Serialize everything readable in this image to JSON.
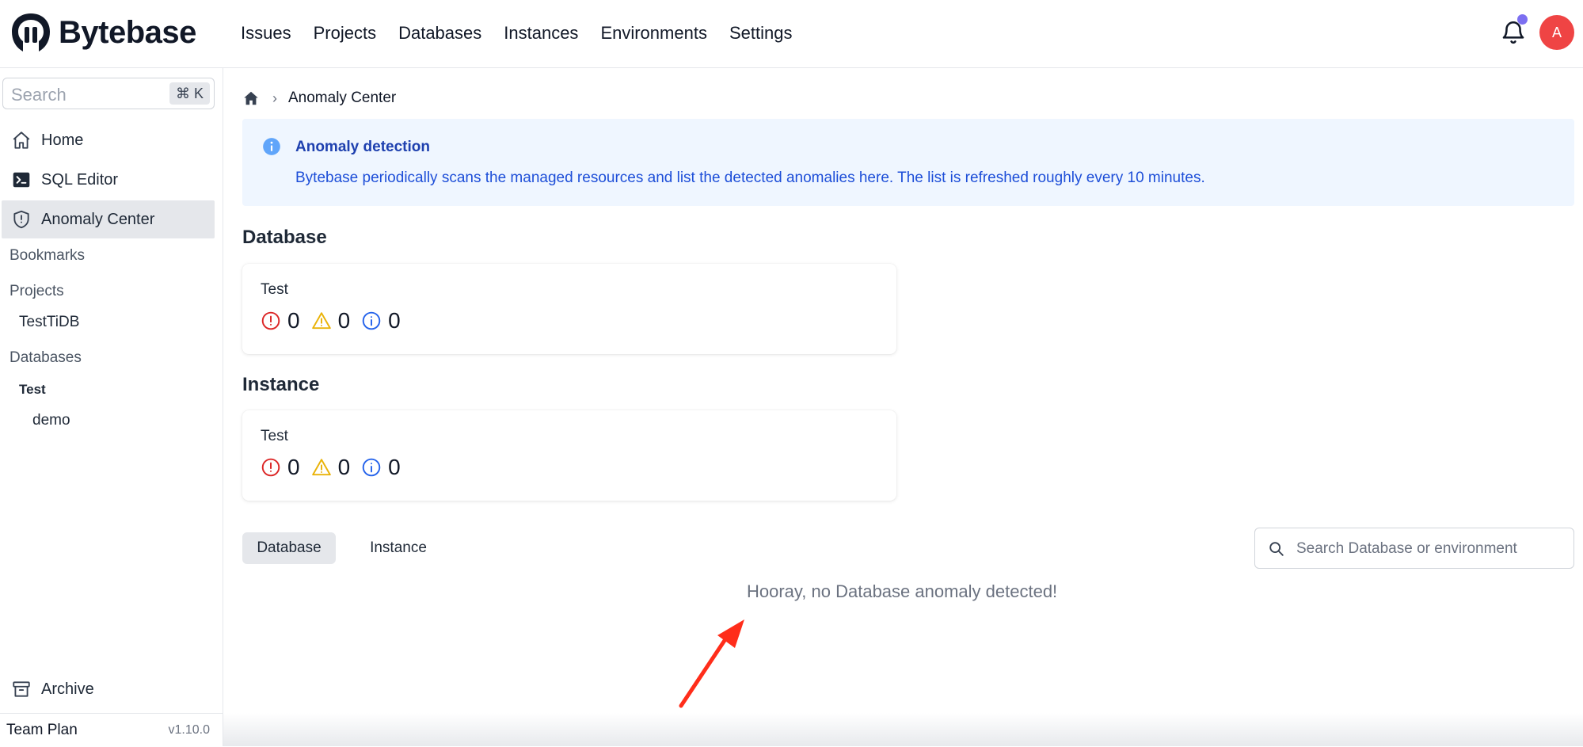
{
  "app": {
    "name": "Bytebase"
  },
  "nav": {
    "items": [
      "Issues",
      "Projects",
      "Databases",
      "Instances",
      "Environments",
      "Settings"
    ]
  },
  "user": {
    "avatar_initial": "A",
    "avatar_color": "#ef4444"
  },
  "sidebar": {
    "search": {
      "placeholder": "Search",
      "shortcut": "⌘ K"
    },
    "items": [
      {
        "label": "Home",
        "icon": "home-icon"
      },
      {
        "label": "SQL Editor",
        "icon": "terminal-icon"
      },
      {
        "label": "Anomaly Center",
        "icon": "shield-icon",
        "active": true
      }
    ],
    "bookmarks_label": "Bookmarks",
    "projects_label": "Projects",
    "projects": [
      "TestTiDB"
    ],
    "databases_label": "Databases",
    "env": "Test",
    "databases": [
      "demo"
    ],
    "archive_label": "Archive",
    "footer": {
      "plan": "Team Plan",
      "version": "v1.10.0"
    }
  },
  "breadcrumb": {
    "current": "Anomaly Center"
  },
  "alert": {
    "title": "Anomaly detection",
    "body": "Bytebase periodically scans the managed resources and list the detected anomalies here. The list is refreshed roughly every 10 minutes."
  },
  "database_section": {
    "title": "Database",
    "card": {
      "name": "Test",
      "errors": "0",
      "warnings": "0",
      "infos": "0"
    }
  },
  "instance_section": {
    "title": "Instance",
    "card": {
      "name": "Test",
      "errors": "0",
      "warnings": "0",
      "infos": "0"
    }
  },
  "tabs": [
    {
      "label": "Database",
      "active": true
    },
    {
      "label": "Instance",
      "active": false
    }
  ],
  "filter": {
    "placeholder": "Search Database or environment"
  },
  "empty_message": "Hooray, no Database anomaly detected!",
  "colors": {
    "error": "#dc2626",
    "warning": "#eab308",
    "info": "#2563eb",
    "annotation_arrow": "#ff2d1a"
  }
}
